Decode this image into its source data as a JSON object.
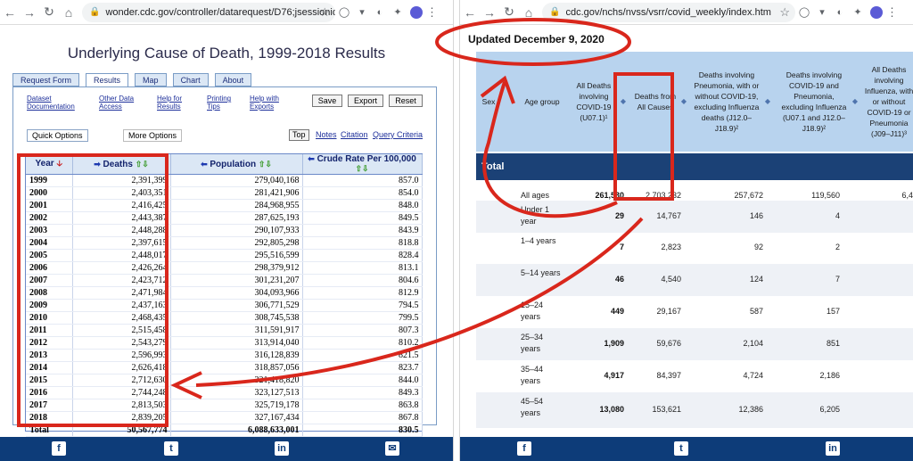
{
  "left_browser": {
    "url": "wonder.cdc.gov/controller/datarequest/D76;jsessionid..."
  },
  "right_browser": {
    "url": "cdc.gov/nchs/nvss/vsrr/covid_weekly/index.htm"
  },
  "wonder": {
    "title": "Underlying Cause of Death, 1999-2018 Results",
    "tabs": [
      "Request Form",
      "Results",
      "Map",
      "Chart",
      "About"
    ],
    "links": {
      "dataset": "Dataset\nDocumentation",
      "other": "Other Data\nAccess",
      "help_results": "Help for\nResults",
      "printing": "Printing\nTips",
      "help_exports": "Help with\nExports"
    },
    "buttons": {
      "save": "Save",
      "export": "Export",
      "reset": "Reset"
    },
    "options": {
      "quick": "Quick Options",
      "more": "More Options"
    },
    "top_links": {
      "top": "Top",
      "notes": "Notes",
      "citation": "Citation",
      "query": "Query Criteria"
    },
    "table": {
      "headers": [
        "Year",
        "Deaths",
        "Population",
        "Crude Rate Per 100,000"
      ],
      "rows": [
        [
          "1999",
          "2,391,399",
          "279,040,168",
          "857.0"
        ],
        [
          "2000",
          "2,403,351",
          "281,421,906",
          "854.0"
        ],
        [
          "2001",
          "2,416,425",
          "284,968,955",
          "848.0"
        ],
        [
          "2002",
          "2,443,387",
          "287,625,193",
          "849.5"
        ],
        [
          "2003",
          "2,448,288",
          "290,107,933",
          "843.9"
        ],
        [
          "2004",
          "2,397,615",
          "292,805,298",
          "818.8"
        ],
        [
          "2005",
          "2,448,017",
          "295,516,599",
          "828.4"
        ],
        [
          "2006",
          "2,426,264",
          "298,379,912",
          "813.1"
        ],
        [
          "2007",
          "2,423,712",
          "301,231,207",
          "804.6"
        ],
        [
          "2008",
          "2,471,984",
          "304,093,966",
          "812.9"
        ],
        [
          "2009",
          "2,437,163",
          "306,771,529",
          "794.5"
        ],
        [
          "2010",
          "2,468,435",
          "308,745,538",
          "799.5"
        ],
        [
          "2011",
          "2,515,458",
          "311,591,917",
          "807.3"
        ],
        [
          "2012",
          "2,543,279",
          "313,914,040",
          "810.2"
        ],
        [
          "2013",
          "2,596,993",
          "316,128,839",
          "821.5"
        ],
        [
          "2014",
          "2,626,418",
          "318,857,056",
          "823.7"
        ],
        [
          "2015",
          "2,712,630",
          "321,418,820",
          "844.0"
        ],
        [
          "2016",
          "2,744,248",
          "323,127,513",
          "849.3"
        ],
        [
          "2017",
          "2,813,503",
          "325,719,178",
          "863.8"
        ],
        [
          "2018",
          "2,839,205",
          "327,167,434",
          "867.8"
        ]
      ],
      "total": [
        "Total",
        "50,567,774",
        "6,088,633,001",
        "830.5"
      ]
    }
  },
  "cdc": {
    "updated": "Updated December 9, 2020",
    "headers": {
      "state_partial": "Sex",
      "age_group": "Age group",
      "covid": "All Deaths involving COVID-19 (U07.1)¹",
      "all_causes": "Deaths from All Causes",
      "pneumonia": "Deaths involving Pneumonia, with or without COVID-19, excluding Influenza deaths (J12.0–J18.9)²",
      "covid_pneu_flu": "Deaths involving COVID-19 and Pneumonia, excluding Influenza (U07.1 and J12.0–J18.9)²",
      "influenza": "All Deaths involving Influenza, with or without COVID-19 or Pneumonia (J09–J11)³"
    },
    "section": "Total",
    "rows": [
      {
        "age": "All ages",
        "covid": "261,530",
        "all": "2,703,232",
        "pneu": "257,672",
        "cp": "119,560",
        "flu": "6,4"
      },
      {
        "age": "Under 1 year",
        "covid": "29",
        "all": "14,767",
        "pneu": "146",
        "cp": "4",
        "flu": ""
      },
      {
        "age": "1–4 years",
        "covid": "7",
        "all": "2,823",
        "pneu": "92",
        "cp": "2",
        "flu": ""
      },
      {
        "age": "5–14 years",
        "covid": "46",
        "all": "4,540",
        "pneu": "124",
        "cp": "7",
        "flu": ""
      },
      {
        "age": "15–24 years",
        "covid": "449",
        "all": "29,167",
        "pneu": "587",
        "cp": "157",
        "flu": ""
      },
      {
        "age": "25–34 years",
        "covid": "1,909",
        "all": "59,676",
        "pneu": "2,104",
        "cp": "851",
        "flu": ""
      },
      {
        "age": "35–44 years",
        "covid": "4,917",
        "all": "84,397",
        "pneu": "4,724",
        "cp": "2,186",
        "flu": ""
      },
      {
        "age": "45–54 years",
        "covid": "13,080",
        "all": "153,621",
        "pneu": "12,386",
        "cp": "6,205",
        "flu": ""
      }
    ]
  },
  "colors": {
    "annotation_red": "#d9271c",
    "footer_blue": "#0d3c79",
    "header_blue": "#b8d3ee",
    "section_blue": "#1b4176"
  },
  "social_icons": [
    "facebook-icon",
    "twitter-icon",
    "linkedin-icon",
    "mail-icon"
  ]
}
